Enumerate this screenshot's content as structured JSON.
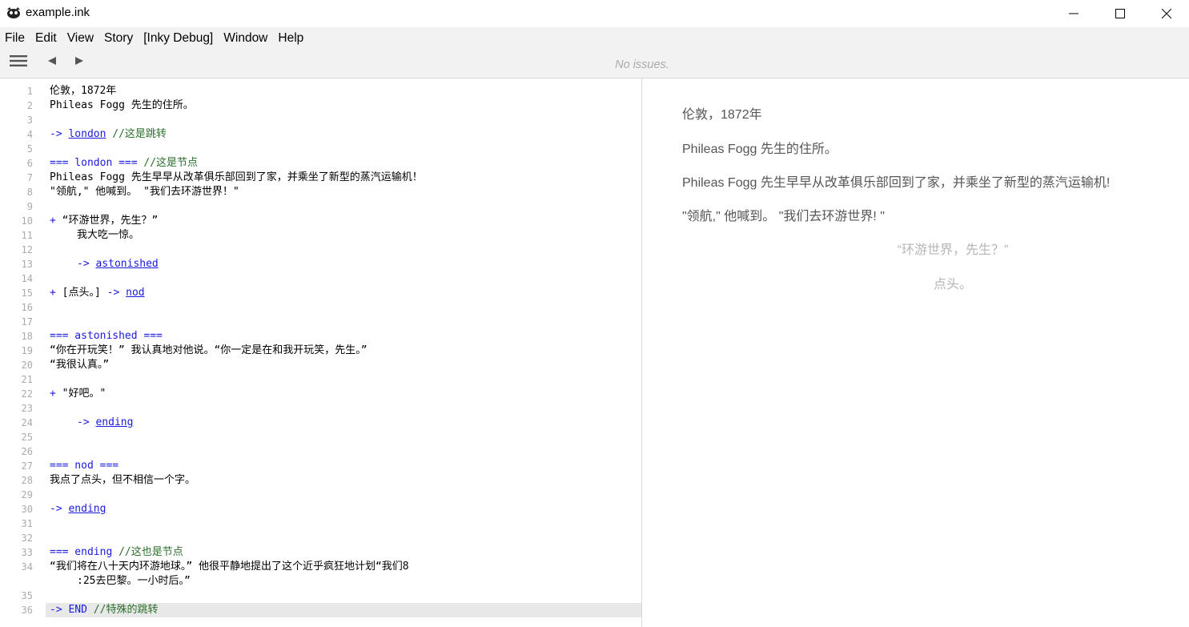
{
  "window": {
    "title": "example.ink",
    "icons": {
      "app": "ink-logo-icon",
      "minimize": "minimize-icon",
      "maximize": "maximize-icon",
      "close": "close-icon"
    }
  },
  "menu": [
    "File",
    "Edit",
    "View",
    "Story",
    "[Inky Debug]",
    "Window",
    "Help"
  ],
  "toolbar": {
    "issues": "No issues.",
    "icons": {
      "menu": "hamburger-icon",
      "back": "back-arrow-icon",
      "forward": "forward-arrow-icon"
    }
  },
  "colors": {
    "keyword": "#1a1ae0",
    "comment": "#2b6e2b",
    "player_text": "#555555",
    "choice_text": "#b5b5b5",
    "line_number": "#aaaaaa"
  },
  "editor": {
    "lines": [
      {
        "n": "1",
        "p1": "伦敦，1872年"
      },
      {
        "n": "2",
        "p1": "Phileas Fogg 先生的住所。"
      },
      {
        "n": "3"
      },
      {
        "n": "4",
        "op": "-> ",
        "link": "london",
        "cm": " //这是跳转"
      },
      {
        "n": "5"
      },
      {
        "n": "6",
        "op": "=== london === ",
        "cm": "//这是节点"
      },
      {
        "n": "7",
        "p1": "Phileas Fogg 先生早早从改革俱乐部回到了家，并乘坐了新型的蒸汽运输机！"
      },
      {
        "n": "8",
        "p1": "\"领航,\" 他喊到。 \"我们去环游世界！\""
      },
      {
        "n": "9"
      },
      {
        "n": "10",
        "op": "+ ",
        "p1": "“环游世界，先生？”"
      },
      {
        "n": "11",
        "p1": "我大吃一惊。",
        "indent": true
      },
      {
        "n": "12"
      },
      {
        "n": "13",
        "op": "-> ",
        "link": "astonished",
        "indent": true
      },
      {
        "n": "14"
      },
      {
        "n": "15",
        "op": "+ ",
        "p1": "[点头。]",
        "op2": " -> ",
        "link": "nod"
      },
      {
        "n": "16"
      },
      {
        "n": "17"
      },
      {
        "n": "18",
        "op": "=== astonished ==="
      },
      {
        "n": "19",
        "p1": "“你在开玩笑！” 我认真地对他说。“你一定是在和我开玩笑，先生。”"
      },
      {
        "n": "20",
        "p1": "“我很认真。”"
      },
      {
        "n": "21"
      },
      {
        "n": "22",
        "op": "+ ",
        "p1": "\"好吧。\""
      },
      {
        "n": "23"
      },
      {
        "n": "24",
        "op": "-> ",
        "link": "ending",
        "indent": true
      },
      {
        "n": "25"
      },
      {
        "n": "26"
      },
      {
        "n": "27",
        "op": "=== nod ==="
      },
      {
        "n": "28",
        "p1": "我点了点头，但不相信一个字。"
      },
      {
        "n": "29"
      },
      {
        "n": "30",
        "op": "-> ",
        "link": "ending"
      },
      {
        "n": "31"
      },
      {
        "n": "32"
      },
      {
        "n": "33",
        "op": "=== ending ",
        "cm": "//这也是节点"
      },
      {
        "n": "34",
        "p1": "“我们将在八十天内环游地球。” 他很平静地提出了这个近乎疯狂地计划“我们8"
      },
      {
        "n": "",
        "p1": ":25去巴黎。一小时后。”",
        "indent": true
      },
      {
        "n": "35"
      },
      {
        "n": "36",
        "op": "-> END ",
        "cm": "//特殊的跳转",
        "active": true
      }
    ]
  },
  "player": {
    "paragraphs": [
      "伦敦，1872年",
      "Phileas Fogg 先生的住所。",
      "Phileas Fogg 先生早早从改革俱乐部回到了家，并乘坐了新型的蒸汽运输机!",
      "\"领航,\" 他喊到。 \"我们去环游世界! \""
    ],
    "choices": [
      "“环游世界，先生？”",
      "点头。"
    ]
  }
}
